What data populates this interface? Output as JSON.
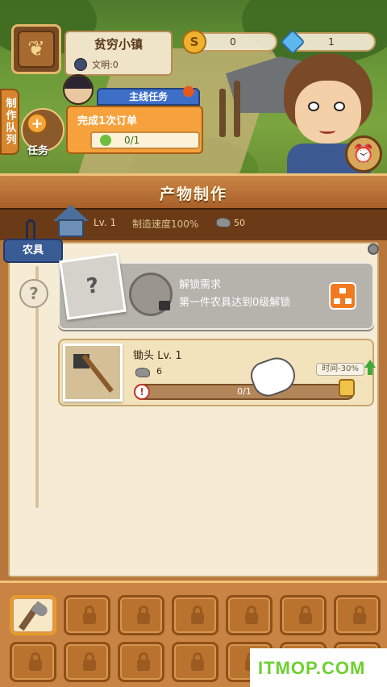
{
  "header": {
    "town_name": "贫穷小镇",
    "civilization": "文明:0",
    "coins": "0",
    "gems": "1",
    "side_tab": "制作队列",
    "task_label": "任务"
  },
  "quest": {
    "header": "主线任务",
    "title": "完成1次订单",
    "progress": "0/1"
  },
  "panel": {
    "title": "产物制作",
    "level": "Lv. 1",
    "speed": "制造速度100%",
    "stone": "50",
    "category_tab": "农具"
  },
  "locked_item": {
    "title": "解锁需求",
    "description": "第一件农具达到0级解锁"
  },
  "hoe_item": {
    "name": "锄头  Lv. 1",
    "cost": "6",
    "progress": "0/1",
    "time_bonus": "时间-30%"
  },
  "slots": {
    "count": 14,
    "active_index": 0
  },
  "watermark": "ITMOP.COM",
  "colors": {
    "accent": "#f07a1e",
    "tab_blue": "#3a5c95",
    "panel_bg": "#f6ecd6"
  }
}
